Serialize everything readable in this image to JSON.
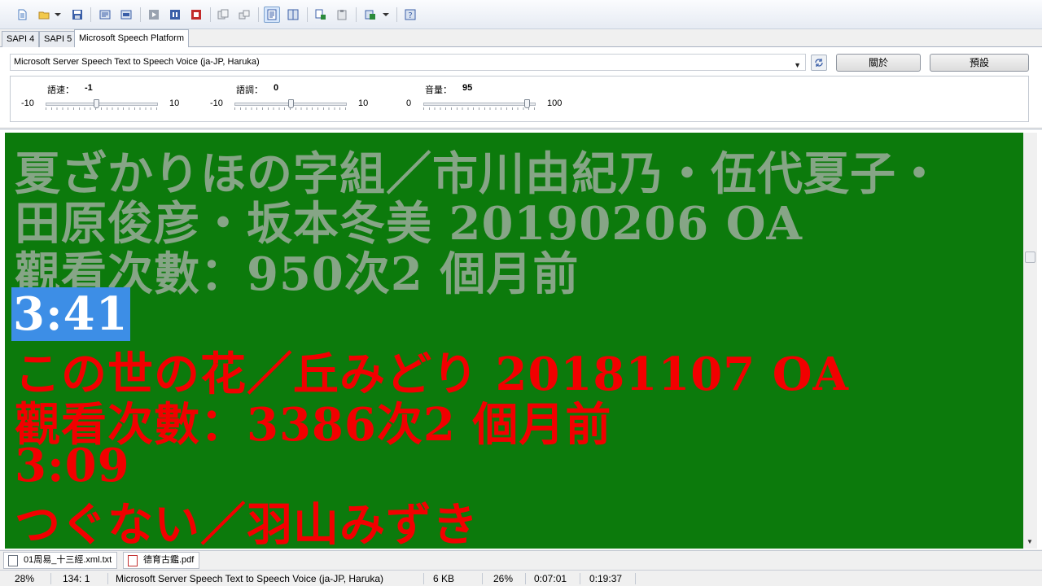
{
  "toolbar": {
    "buttons": [
      {
        "name": "new-document-icon",
        "color": "#4a7bc0"
      },
      {
        "name": "open-folder-icon",
        "color": "#e3b43c"
      },
      {
        "name": "save-icon",
        "color": "#3b5fa8"
      },
      {
        "name": "speak-all-icon",
        "color": "#3b5fa8"
      },
      {
        "name": "speak-selection-icon",
        "color": "#3b5fa8"
      },
      {
        "name": "play-icon",
        "color": "#6b7686"
      },
      {
        "name": "pause-icon",
        "color": "#3b5fa8"
      },
      {
        "name": "stop-icon",
        "color": "#c22b2b"
      },
      {
        "name": "export-icon",
        "color": "#8a8f98"
      },
      {
        "name": "convert-icon",
        "color": "#8a8f98"
      },
      {
        "name": "text-mode-icon",
        "color": "#3b5fa8"
      },
      {
        "name": "split-view-icon",
        "color": "#3b5fa8"
      },
      {
        "name": "copy-icon",
        "color": "#2a8a3a"
      },
      {
        "name": "paste-icon",
        "color": "#8a8f98"
      },
      {
        "name": "settings-icon",
        "color": "#3b5fa8"
      },
      {
        "name": "help-icon",
        "color": "#3b5fa8"
      }
    ]
  },
  "sapi_tabs": [
    {
      "label": "SAPI 4"
    },
    {
      "label": "SAPI 5"
    },
    {
      "label": "Microsoft Speech Platform"
    }
  ],
  "voice_panel": {
    "selected_voice": "Microsoft Server Speech Text to Speech Voice (ja-JP, Haruka)",
    "about_label": "關於",
    "default_label": "預設",
    "sliders": [
      {
        "label": "語速：",
        "value": "-1",
        "min": "-10",
        "max": "10",
        "level": 0.45
      },
      {
        "label": "語調：",
        "value": "0",
        "min": "-10",
        "max": "10",
        "level": 0.5
      },
      {
        "label": "音量：",
        "value": "95",
        "min": "0",
        "max": "100",
        "level": 0.95
      }
    ]
  },
  "text_area": {
    "bg_color": "#0c7a0c",
    "lines": [
      {
        "text": "夏ざかりほの字組／市川由紀乃・伍代夏子・",
        "style": "gray"
      },
      {
        "text": "田原俊彦・坂本冬美 20190206 OA",
        "style": "gray"
      },
      {
        "text": "觀看次數：950次2 個月前",
        "style": "gray"
      },
      {
        "text": "3:41",
        "style": "selected"
      },
      {
        "text": "この世の花／丘みどり 20181107 OA",
        "style": "red"
      },
      {
        "text": "觀看次數：3386次2 個月前",
        "style": "red"
      },
      {
        "text": "3:09",
        "style": "red"
      },
      {
        "text": "つぐない／羽山みずき",
        "style": "red"
      }
    ]
  },
  "doc_tabs": [
    {
      "label": "01周易_十三經.xml.txt",
      "icon": "text-file-icon"
    },
    {
      "label": "德育古鑑.pdf",
      "icon": "pdf-file-icon"
    }
  ],
  "status_bar": {
    "zoom": "28%",
    "position": "134:  1",
    "voice": "Microsoft Server Speech Text to Speech Voice (ja-JP, Haruka)",
    "size": "6 KB",
    "progress": "26%",
    "elapsed": "0:07:01",
    "total": "0:19:37"
  }
}
